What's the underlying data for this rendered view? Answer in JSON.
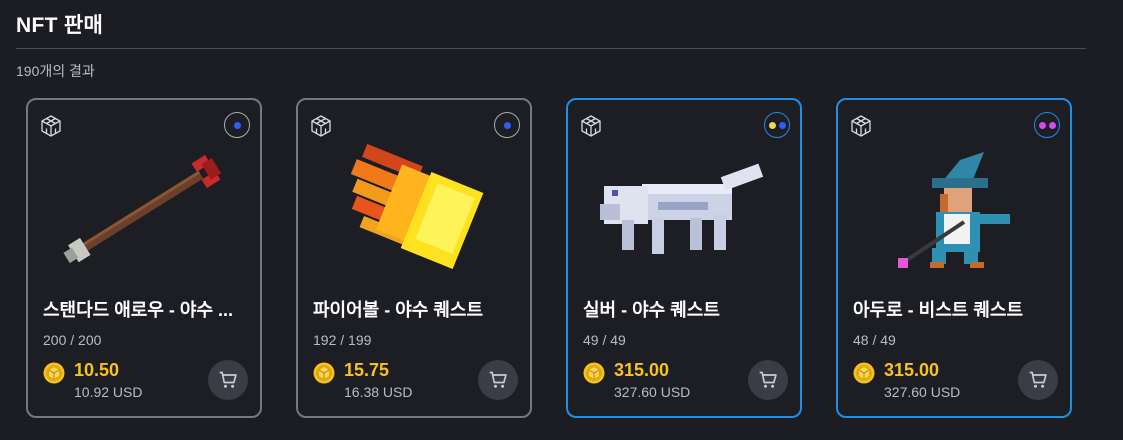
{
  "header": {
    "title": "NFT 판매",
    "result_count": "190개의 결과"
  },
  "colors": {
    "background": "#1b1d23",
    "card_border": "#75787f",
    "card_border_highlight": "#1f8ee3",
    "price": "#f7c21c"
  },
  "cards": [
    {
      "icon": "voxel-model-icon",
      "name": "스탠다드 애로우 - 야수 ...",
      "stock": "200 / 200",
      "price": "10.50",
      "usd": "10.92 USD",
      "highlighted": false,
      "chain_dots": [
        "#2f5bff"
      ],
      "art": "voxel-arrow"
    },
    {
      "icon": "voxel-model-icon",
      "name": "파이어볼 - 야수 퀘스트",
      "stock": "192 / 199",
      "price": "15.75",
      "usd": "16.38 USD",
      "highlighted": false,
      "chain_dots": [
        "#2f5bff"
      ],
      "art": "voxel-fireball"
    },
    {
      "icon": "voxel-model-icon",
      "name": "실버 - 야수 퀘스트",
      "stock": "49 / 49",
      "price": "315.00",
      "usd": "327.60 USD",
      "highlighted": true,
      "chain_dots": [
        "#f2d54a",
        "#2f5bff"
      ],
      "art": "voxel-wolf"
    },
    {
      "icon": "voxel-model-icon",
      "name": "아두로 - 비스트 퀘스트",
      "stock": "48 / 49",
      "price": "315.00",
      "usd": "327.60 USD",
      "highlighted": true,
      "chain_dots": [
        "#d64bf0",
        "#d64bf0"
      ],
      "art": "voxel-wizard"
    }
  ]
}
